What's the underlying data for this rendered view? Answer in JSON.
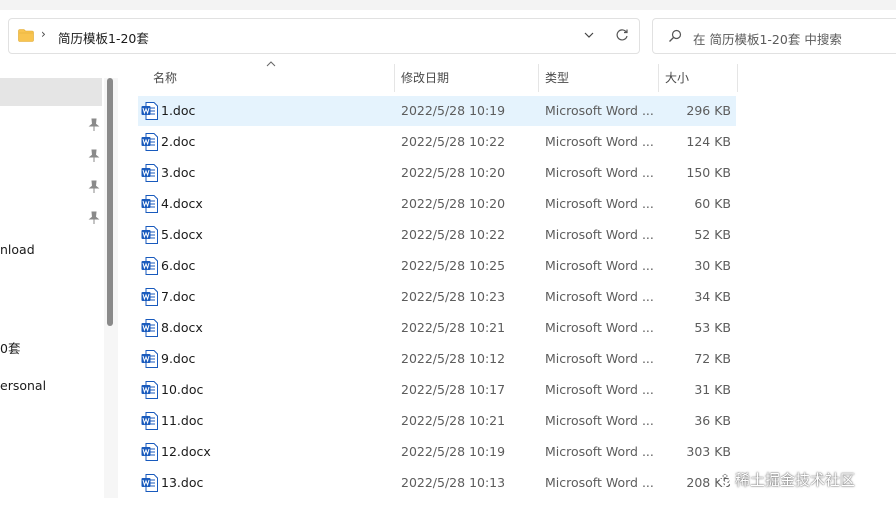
{
  "address": {
    "breadcrumb": "简历模板1-20套"
  },
  "search": {
    "placeholder": "在 简历模板1-20套 中搜索"
  },
  "nav_partial": {
    "item_download": "nload",
    "item_folder": "0套",
    "item_personal": "ersonal"
  },
  "columns": {
    "name": "名称",
    "date": "修改日期",
    "type": "类型",
    "size": "大小"
  },
  "files": [
    {
      "name": "1.doc",
      "date": "2022/5/28 10:19",
      "type": "Microsoft Word ...",
      "size": "296 KB",
      "selected": true
    },
    {
      "name": "2.doc",
      "date": "2022/5/28 10:22",
      "type": "Microsoft Word ...",
      "size": "124 KB"
    },
    {
      "name": "3.doc",
      "date": "2022/5/28 10:20",
      "type": "Microsoft Word ...",
      "size": "150 KB"
    },
    {
      "name": "4.docx",
      "date": "2022/5/28 10:20",
      "type": "Microsoft Word ...",
      "size": "60 KB"
    },
    {
      "name": "5.docx",
      "date": "2022/5/28 10:22",
      "type": "Microsoft Word ...",
      "size": "52 KB"
    },
    {
      "name": "6.doc",
      "date": "2022/5/28 10:25",
      "type": "Microsoft Word ...",
      "size": "30 KB"
    },
    {
      "name": "7.doc",
      "date": "2022/5/28 10:23",
      "type": "Microsoft Word ...",
      "size": "34 KB"
    },
    {
      "name": "8.docx",
      "date": "2022/5/28 10:21",
      "type": "Microsoft Word ...",
      "size": "53 KB"
    },
    {
      "name": "9.doc",
      "date": "2022/5/28 10:12",
      "type": "Microsoft Word ...",
      "size": "72 KB"
    },
    {
      "name": "10.doc",
      "date": "2022/5/28 10:17",
      "type": "Microsoft Word ...",
      "size": "31 KB"
    },
    {
      "name": "11.doc",
      "date": "2022/5/28 10:21",
      "type": "Microsoft Word ...",
      "size": "36 KB"
    },
    {
      "name": "12.docx",
      "date": "2022/5/28 10:19",
      "type": "Microsoft Word ...",
      "size": "303 KB"
    },
    {
      "name": "13.doc",
      "date": "2022/5/28 10:13",
      "type": "Microsoft Word ...",
      "size": "208 KB"
    }
  ],
  "watermark": "稀土掘金技术社区",
  "colors": {
    "selection": "#e5f3fd",
    "word_blue": "#185abd",
    "folder_yellow": "#f8c44f"
  }
}
